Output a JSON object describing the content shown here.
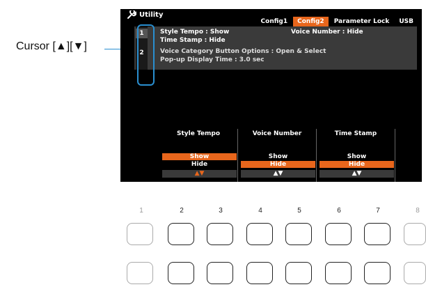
{
  "callout": {
    "label": "Cursor [▲][▼]"
  },
  "screen": {
    "title": "Utility",
    "tabs": [
      {
        "label": "Config1",
        "active": false
      },
      {
        "label": "Config2",
        "active": true
      },
      {
        "label": "Parameter Lock",
        "active": false
      },
      {
        "label": "USB",
        "active": false
      }
    ],
    "items": [
      {
        "num": "1",
        "lines": [
          "Style Tempo : Show",
          "Time Stamp : Hide"
        ],
        "extra": "Voice Number : Hide",
        "selected": true
      },
      {
        "num": "2",
        "lines": [
          "Voice Category Button Options : Open & Select",
          "Pop-up Display Time : 3.0 sec"
        ],
        "selected": false
      }
    ],
    "params": [
      {
        "header": "Style Tempo",
        "options": [
          "Show",
          "Hide"
        ],
        "selected": "Show",
        "arrows": "▲▼"
      },
      {
        "header": "Voice Number",
        "options": [
          "Show",
          "Hide"
        ],
        "selected": "Hide",
        "arrows": "▲▼"
      },
      {
        "header": "Time Stamp",
        "options": [
          "Show",
          "Hide"
        ],
        "selected": "Hide",
        "arrows": "▲▼"
      }
    ]
  },
  "buttons": {
    "numbers": [
      "1",
      "2",
      "3",
      "4",
      "5",
      "6",
      "7",
      "8"
    ]
  },
  "colors": {
    "accent": "#e8661c",
    "callout": "#2a8fd0",
    "screen_bg": "#000000"
  }
}
